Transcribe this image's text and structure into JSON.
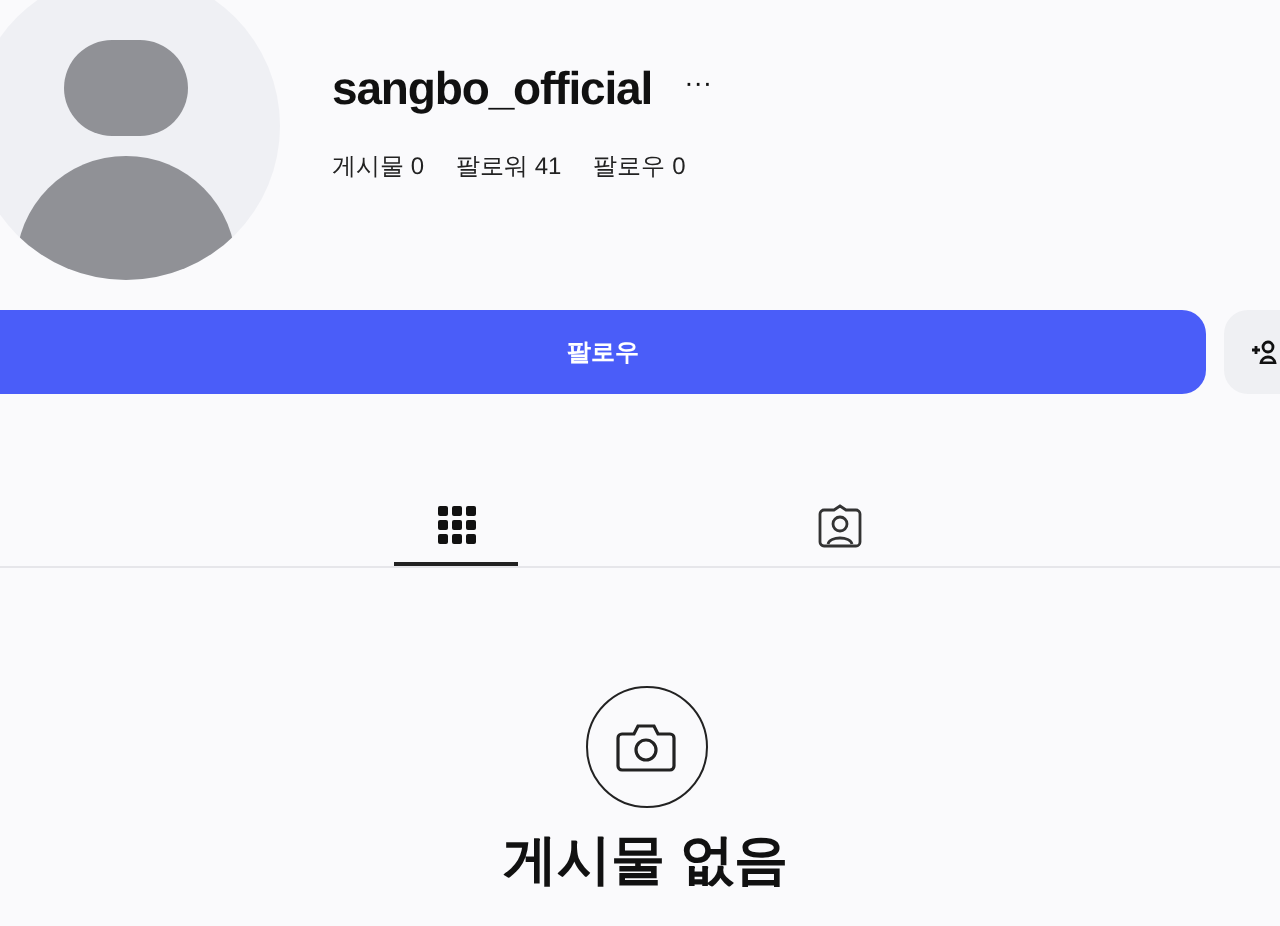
{
  "profile": {
    "username": "sangbo_official",
    "more": "···",
    "stats": [
      {
        "label": "게시물",
        "value": "0"
      },
      {
        "label": "팔로워",
        "value": "41"
      },
      {
        "label": "팔로우",
        "value": "0"
      }
    ]
  },
  "follow_button": {
    "label": "팔로우"
  },
  "tabs": [
    {
      "kind": "grid",
      "selected": true
    },
    {
      "kind": "tagged",
      "selected": false
    }
  ],
  "empty_state": {
    "title": "게시물 없음"
  }
}
